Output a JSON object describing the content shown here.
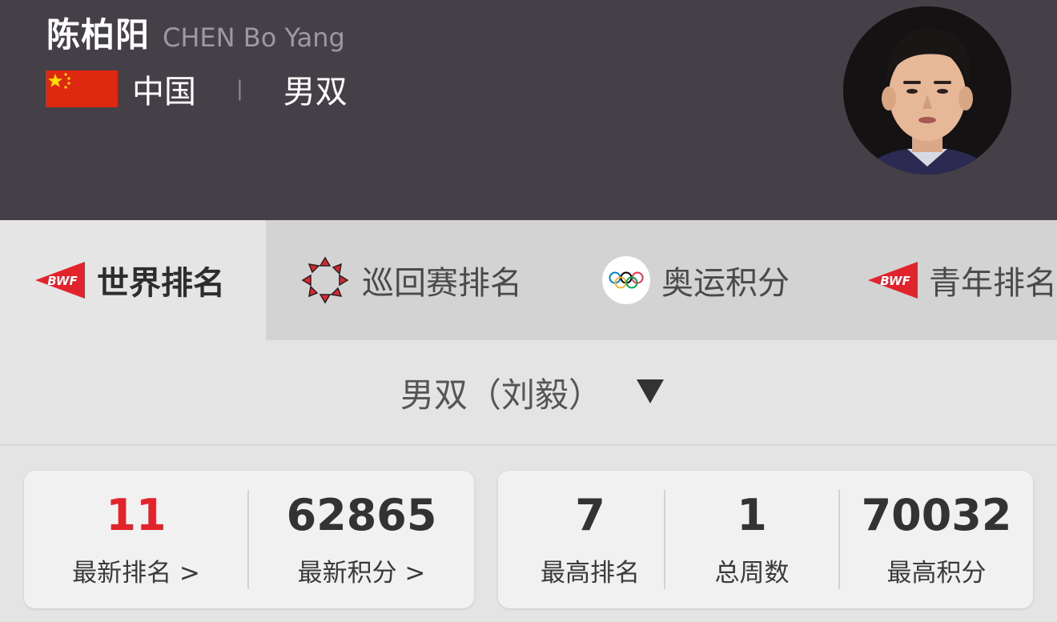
{
  "player": {
    "name_cn": "陈柏阳",
    "name_en": "CHEN Bo Yang",
    "country": "中国",
    "separator": "|",
    "event": "男双"
  },
  "tabs": [
    {
      "label": "世界排名",
      "icon": "bwf-logo-icon",
      "active": true
    },
    {
      "label": "巡回赛排名",
      "icon": "tour-logo-icon",
      "active": false
    },
    {
      "label": "奥运积分",
      "icon": "olympic-rings-icon",
      "active": false
    },
    {
      "label": "青年排名",
      "icon": "bwf-logo-icon",
      "active": false
    }
  ],
  "bwf_logo_text": "BWF",
  "category_selector": {
    "value": "男双（刘毅）",
    "arrow": "▼"
  },
  "stats_current": [
    {
      "value": "11",
      "label": "最新排名 >",
      "highlight": true
    },
    {
      "value": "62865",
      "label": "最新积分 >",
      "highlight": false
    }
  ],
  "stats_best": [
    {
      "value": "7",
      "label": "最高排名"
    },
    {
      "value": "1",
      "label": "总周数"
    },
    {
      "value": "70032",
      "label": "最高积分"
    }
  ],
  "colors": {
    "header_bg": "#453f48",
    "flag_red": "#de2910",
    "flag_yellow": "#ffde00",
    "bwf_red": "#e3232c",
    "rank_red": "#e3232c"
  }
}
